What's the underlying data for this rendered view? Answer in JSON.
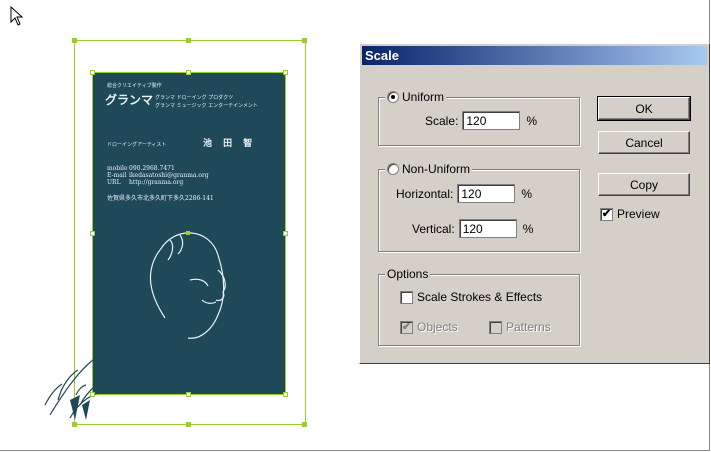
{
  "card": {
    "company_small": "総合クリエイティブ製作",
    "brand": "グランマ",
    "brand_line1": "グランマ ドローイング プロダクツ",
    "brand_line2": "グランマ ミュージック エンターテインメント",
    "role": "ドローイングアーティスト",
    "name": "池 田 智",
    "contacts": [
      {
        "label": "mobile",
        "value": "090.2968.7471"
      },
      {
        "label": "E-mail",
        "value": "ikedasatoshi@granma.org"
      },
      {
        "label": "URL",
        "value": "http://granma.org"
      }
    ],
    "address": "佐賀県多久市北多久町下多久2286-141"
  },
  "dialog": {
    "title": "Scale",
    "uniform": {
      "label": "Uniform",
      "selected": true,
      "scale_label": "Scale:",
      "scale_value": "120",
      "unit": "%"
    },
    "non_uniform": {
      "label": "Non-Uniform",
      "selected": false,
      "horizontal_label": "Horizontal:",
      "horizontal_value": "120",
      "vertical_label": "Vertical:",
      "vertical_value": "120",
      "unit": "%"
    },
    "options": {
      "label": "Options",
      "scale_strokes_label": "Scale Strokes & Effects",
      "scale_strokes_checked": false,
      "objects_label": "Objects",
      "objects_checked": true,
      "patterns_label": "Patterns",
      "patterns_checked": false
    },
    "buttons": {
      "ok": "OK",
      "cancel": "Cancel",
      "copy": "Copy"
    },
    "preview": {
      "label": "Preview",
      "checked": true
    }
  },
  "colors": {
    "card_bg": "#1f4958",
    "selection": "#9acd32",
    "dialog_bg": "#d4d0c8",
    "title_start": "#0a246a",
    "title_end": "#a6caf0"
  }
}
